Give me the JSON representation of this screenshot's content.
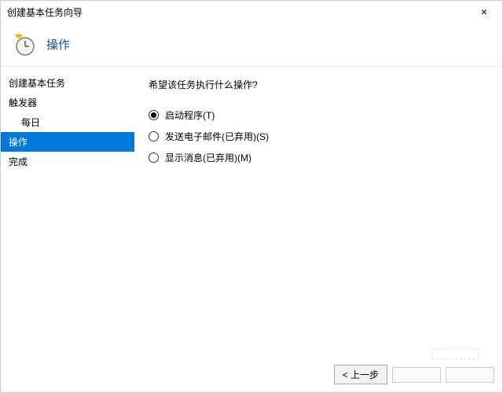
{
  "window": {
    "title": "创建基本任务向导"
  },
  "header": {
    "page_title": "操作"
  },
  "sidebar": {
    "items": [
      {
        "label": "创建基本任务",
        "active": false,
        "indent": false
      },
      {
        "label": "触发器",
        "active": false,
        "indent": false
      },
      {
        "label": "每日",
        "active": false,
        "indent": true
      },
      {
        "label": "操作",
        "active": true,
        "indent": false
      },
      {
        "label": "完成",
        "active": false,
        "indent": false
      }
    ]
  },
  "content": {
    "prompt": "希望该任务执行什么操作?",
    "options": [
      {
        "label": "启动程序(T)",
        "checked": true
      },
      {
        "label": "发送电子邮件(已弃用)(S)",
        "checked": false
      },
      {
        "label": "显示消息(已弃用)(M)",
        "checked": false
      }
    ]
  },
  "footer": {
    "back": "< 上一步"
  }
}
